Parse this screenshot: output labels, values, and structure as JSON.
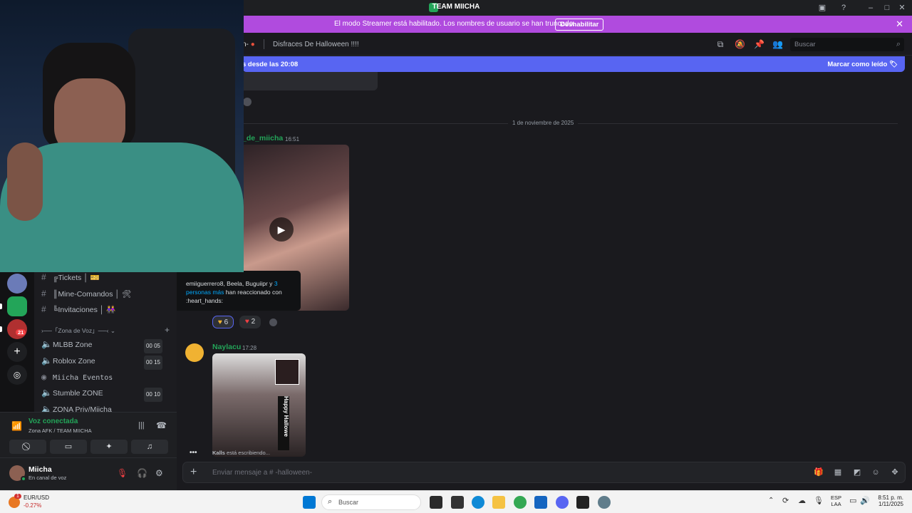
{
  "window": {
    "title": "TEAM MIICHA"
  },
  "banner": {
    "message": "El modo Streamer está habilitado. Los nombres de usuario se han truncado.",
    "button": "Deshabilitar"
  },
  "channel_header": {
    "name": "n-",
    "topic": "Disfraces De Halloween !!!!",
    "search_placeholder": "Buscar"
  },
  "new_messages_bar": {
    "left_text": "s desde las 20:08",
    "right_text": "Marcar como leído"
  },
  "chat": {
    "date_divider": "1 de noviembre de 2025",
    "messages": [
      {
        "author": "_de_miicha",
        "time": "16:51"
      },
      {
        "author": "Naylacu",
        "time": "17:28"
      }
    ],
    "reactions": [
      {
        "count": "6"
      },
      {
        "count": "2"
      }
    ],
    "tooltip": {
      "users": "emiiguerrero8, Beela, Buguiipr y",
      "more": "3 personas más",
      "tail": "han reaccionado con",
      "emoji": ":heart_hands:"
    },
    "typing": {
      "user": "Kalls",
      "text": "está escribiendo..."
    }
  },
  "media": {
    "video2_caption": "Happy Hallowe"
  },
  "guilds": {
    "badge": "21"
  },
  "channels": {
    "text": [
      {
        "label": "╔Tickets │ 🎫"
      },
      {
        "label": "║Mine-Comandos │ 🛠"
      },
      {
        "label": "╚Invitaciones │ 👭"
      }
    ],
    "category": "›──「Zona de Voz」──‹",
    "voice": [
      {
        "label": "MLBB Zone",
        "count": "00 05"
      },
      {
        "label": "Roblox Zone",
        "count": "00 15"
      },
      {
        "label": "Miicha Eventos",
        "count": ""
      },
      {
        "label": "Stumble ZONE",
        "count": "00 10"
      },
      {
        "label": "ZONA Priv/Miicha",
        "count": ""
      }
    ]
  },
  "voice_panel": {
    "status": "Voz conectada",
    "location": "Zona AFK / TEAM MIICHA"
  },
  "user_panel": {
    "name": "Miicha",
    "status": "En canal de voz"
  },
  "input": {
    "placeholder": "Enviar mensaje a # -halloween-"
  },
  "taskbar": {
    "ticker": {
      "pair": "EUR/USD",
      "change": "-0.27%",
      "badge": "1"
    },
    "search": "Buscar",
    "lang": "ESP",
    "layout": "LAA",
    "time": "8:51 p. m.",
    "date": "1/11/2025"
  },
  "colors": {
    "accent": "#5865f2",
    "streamer": "#b04bde",
    "online": "#23a559"
  }
}
